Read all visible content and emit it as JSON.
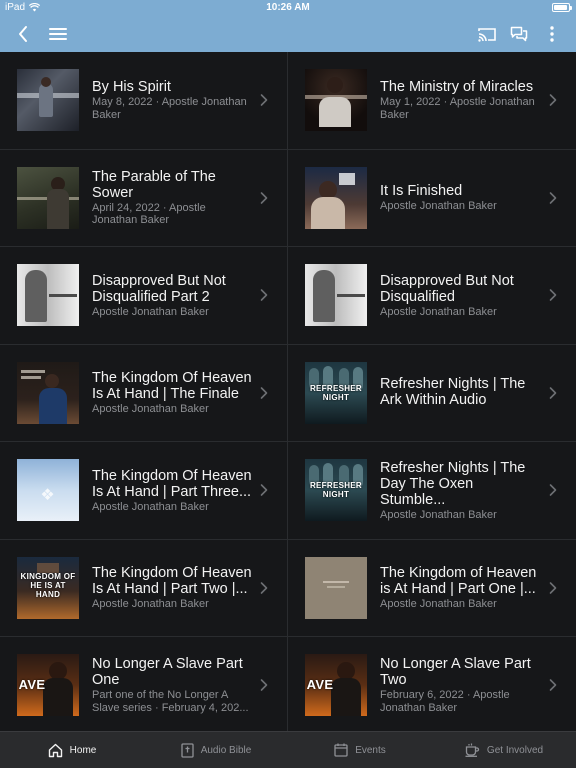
{
  "status_bar": {
    "device": "iPad",
    "time": "10:26 AM"
  },
  "nav": {
    "back_icon": "chevron-left-icon",
    "menu_icon": "hamburger-menu-icon",
    "cast_icon": "cast-icon",
    "chat_icon": "chat-bubbles-icon",
    "more_icon": "more-vertical-icon"
  },
  "colors": {
    "accent": "#7dacd2",
    "background": "#161719",
    "tab_bar": "#2a2b2d"
  },
  "items": [
    {
      "title": "By His Spirit",
      "subtitle": "May 8, 2022 · Apostle Jonathan Baker",
      "thumb_caption": ""
    },
    {
      "title": "The Ministry of Miracles",
      "subtitle": "May 1, 2022 · Apostle Jonathan Baker",
      "thumb_caption": ""
    },
    {
      "title": "The Parable of The Sower",
      "subtitle": "April 24, 2022 · Apostle Jonathan Baker",
      "thumb_caption": ""
    },
    {
      "title": "It Is Finished",
      "subtitle": "Apostle Jonathan Baker",
      "thumb_caption": ""
    },
    {
      "title": "Disapproved But Not Disqualified Part 2",
      "subtitle": "Apostle Jonathan Baker",
      "thumb_caption": ""
    },
    {
      "title": "Disapproved But Not Disqualified",
      "subtitle": "Apostle Jonathan Baker",
      "thumb_caption": ""
    },
    {
      "title": "The Kingdom Of Heaven Is At Hand | The Finale",
      "subtitle": "Apostle Jonathan Baker",
      "thumb_caption": ""
    },
    {
      "title": "Refresher Nights | The Ark Within Audio",
      "subtitle": "",
      "thumb_caption": "REFRESHER NIGHT"
    },
    {
      "title": "The Kingdom Of Heaven Is At Hand | Part Three...",
      "subtitle": "Apostle Jonathan Baker",
      "thumb_caption": ""
    },
    {
      "title": "Refresher Nights | The Day The Oxen Stumble...",
      "subtitle": "Apostle Jonathan Baker",
      "thumb_caption": "REFRESHER NIGHT"
    },
    {
      "title": "The Kingdom Of Heaven Is At Hand | Part Two |...",
      "subtitle": "Apostle Jonathan Baker",
      "thumb_caption": "KINGDOM OF HE IS AT HAND"
    },
    {
      "title": "The Kingdom of Heaven is At Hand | Part One |...",
      "subtitle": "Apostle Jonathan Baker",
      "thumb_caption": ""
    },
    {
      "title": "No Longer A Slave Part One",
      "subtitle": "Part one of the No Longer A Slave series · February 4, 202...",
      "thumb_caption": "AVE"
    },
    {
      "title": "No Longer A Slave Part Two",
      "subtitle": "February 6, 2022 · Apostle Jonathan Baker",
      "thumb_caption": "AVE"
    }
  ],
  "tabs": [
    {
      "label": "Home",
      "icon": "home-icon",
      "active": true
    },
    {
      "label": "Audio Bible",
      "icon": "bible-icon",
      "active": false
    },
    {
      "label": "Events",
      "icon": "calendar-icon",
      "active": false
    },
    {
      "label": "Get Involved",
      "icon": "coffee-cup-icon",
      "active": false
    }
  ]
}
